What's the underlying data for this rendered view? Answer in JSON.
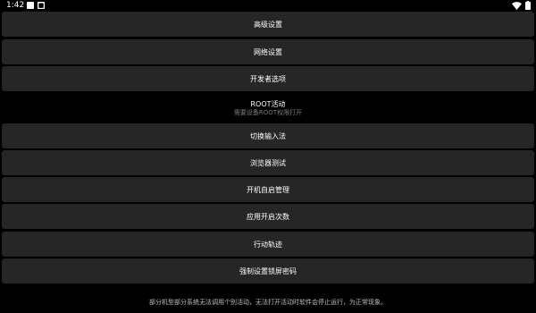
{
  "status_bar": {
    "time": "1:42",
    "notification_icons": [
      "square-notification-icon",
      "app-notification-icon"
    ],
    "wifi": "wifi-icon",
    "battery": "battery-icon"
  },
  "menu": {
    "items": [
      {
        "label": "高级设置"
      },
      {
        "label": "网络设置"
      },
      {
        "label": "开发者选项"
      },
      {
        "label": "切换输入法"
      },
      {
        "label": "浏览器测试"
      },
      {
        "label": "开机自启管理"
      },
      {
        "label": "应用开启次数"
      },
      {
        "label": "行动轨迹"
      },
      {
        "label": "强制设置锁屏密码"
      }
    ],
    "root": {
      "title": "ROOT活动",
      "subtitle": "需要设备ROOT权限打开"
    }
  },
  "footer": {
    "note": "部分机型部分系统无法调用个别活动，无法打开活动时软件会停止运行，为正常现象。"
  },
  "colors": {
    "background": "#000000",
    "button": "#262626",
    "text": "#ffffff",
    "muted": "#7a7a7a"
  }
}
